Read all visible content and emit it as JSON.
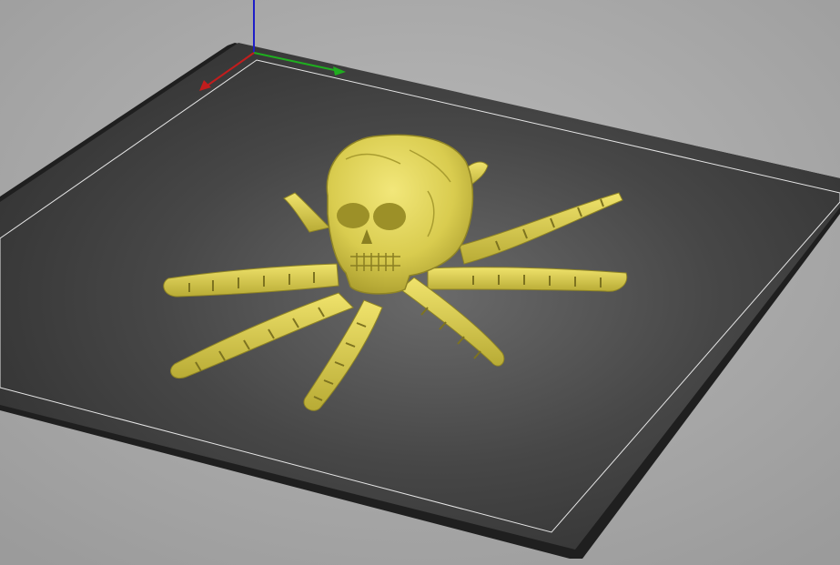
{
  "viewport": {
    "name": "3d-print-bed-view",
    "background_color": "#a3a3a3",
    "bed_color": "#2e2e2e",
    "bed_border_color": "#e6e6e6",
    "model_color": "#e0d45a",
    "axes": {
      "x_color": "#c21d1d",
      "y_color": "#1fae1f",
      "z_color": "#1e1ec8"
    }
  }
}
